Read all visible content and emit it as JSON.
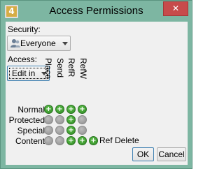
{
  "window": {
    "title": "Access Permissions",
    "app_icon_text": "4",
    "close_glyph": "✕"
  },
  "security": {
    "label": "Security:",
    "selected": "Everyone",
    "icon": "person-icon"
  },
  "access": {
    "label": "Access:",
    "selected": "Edit in"
  },
  "permissions": {
    "columns": [
      "Place",
      "Send",
      "RefR",
      "RefW"
    ],
    "rows": [
      {
        "label": "Normal",
        "states": [
          true,
          true,
          true,
          true
        ]
      },
      {
        "label": "Protected",
        "states": [
          false,
          false,
          true,
          false
        ]
      },
      {
        "label": "Special",
        "states": [
          false,
          false,
          true,
          false
        ]
      },
      {
        "label": "Content",
        "states": [
          false,
          false,
          true,
          true
        ]
      }
    ],
    "extra": {
      "label": "Ref Delete",
      "state": true
    },
    "colors": {
      "on": "#3aa12c",
      "off": "#a6a6a6"
    }
  },
  "buttons": {
    "ok": "OK",
    "cancel": "Cancel"
  },
  "colors": {
    "window_frame": "#7db6a2",
    "close_button": "#c74b4b",
    "app_icon": "#d6ac45"
  }
}
